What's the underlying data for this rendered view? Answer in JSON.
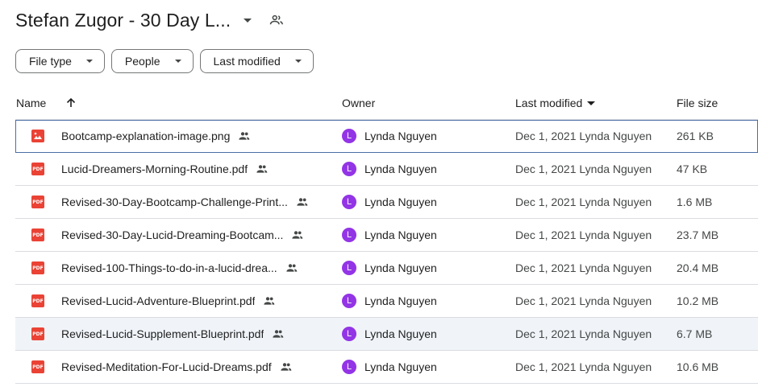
{
  "header": {
    "title": "Stefan Zugor - 30 Day L..."
  },
  "filters": [
    {
      "label": "File type"
    },
    {
      "label": "People"
    },
    {
      "label": "Last modified"
    }
  ],
  "columns": {
    "name": "Name",
    "owner": "Owner",
    "last_modified": "Last modified",
    "file_size": "File size"
  },
  "colors": {
    "pdf": "#ea4335",
    "avatar": "#9334e6",
    "selected_border": "#4a6fa5"
  },
  "files": [
    {
      "icon": "image-icon",
      "name": "Bootcamp-explanation-image.png",
      "owner": "Lynda Nguyen",
      "owner_initial": "L",
      "modified": "Dec 1, 2021 Lynda Nguyen",
      "size": "261 KB"
    },
    {
      "icon": "pdf-icon",
      "icon_text": "PDF",
      "name": "Lucid-Dreamers-Morning-Routine.pdf",
      "owner": "Lynda Nguyen",
      "owner_initial": "L",
      "modified": "Dec 1, 2021 Lynda Nguyen",
      "size": "47 KB"
    },
    {
      "icon": "pdf-icon",
      "icon_text": "PDF",
      "name": "Revised-30-Day-Bootcamp-Challenge-Print...",
      "owner": "Lynda Nguyen",
      "owner_initial": "L",
      "modified": "Dec 1, 2021 Lynda Nguyen",
      "size": "1.6 MB"
    },
    {
      "icon": "pdf-icon",
      "icon_text": "PDF",
      "name": "Revised-30-Day-Lucid-Dreaming-Bootcam...",
      "owner": "Lynda Nguyen",
      "owner_initial": "L",
      "modified": "Dec 1, 2021 Lynda Nguyen",
      "size": "23.7 MB"
    },
    {
      "icon": "pdf-icon",
      "icon_text": "PDF",
      "name": "Revised-100-Things-to-do-in-a-lucid-drea...",
      "owner": "Lynda Nguyen",
      "owner_initial": "L",
      "modified": "Dec 1, 2021 Lynda Nguyen",
      "size": "20.4 MB"
    },
    {
      "icon": "pdf-icon",
      "icon_text": "PDF",
      "name": "Revised-Lucid-Adventure-Blueprint.pdf",
      "owner": "Lynda Nguyen",
      "owner_initial": "L",
      "modified": "Dec 1, 2021 Lynda Nguyen",
      "size": "10.2 MB"
    },
    {
      "icon": "pdf-icon",
      "icon_text": "PDF",
      "name": "Revised-Lucid-Supplement-Blueprint.pdf",
      "owner": "Lynda Nguyen",
      "owner_initial": "L",
      "modified": "Dec 1, 2021 Lynda Nguyen",
      "size": "6.7 MB"
    },
    {
      "icon": "pdf-icon",
      "icon_text": "PDF",
      "name": "Revised-Meditation-For-Lucid-Dreams.pdf",
      "owner": "Lynda Nguyen",
      "owner_initial": "L",
      "modified": "Dec 1, 2021 Lynda Nguyen",
      "size": "10.6 MB"
    }
  ]
}
